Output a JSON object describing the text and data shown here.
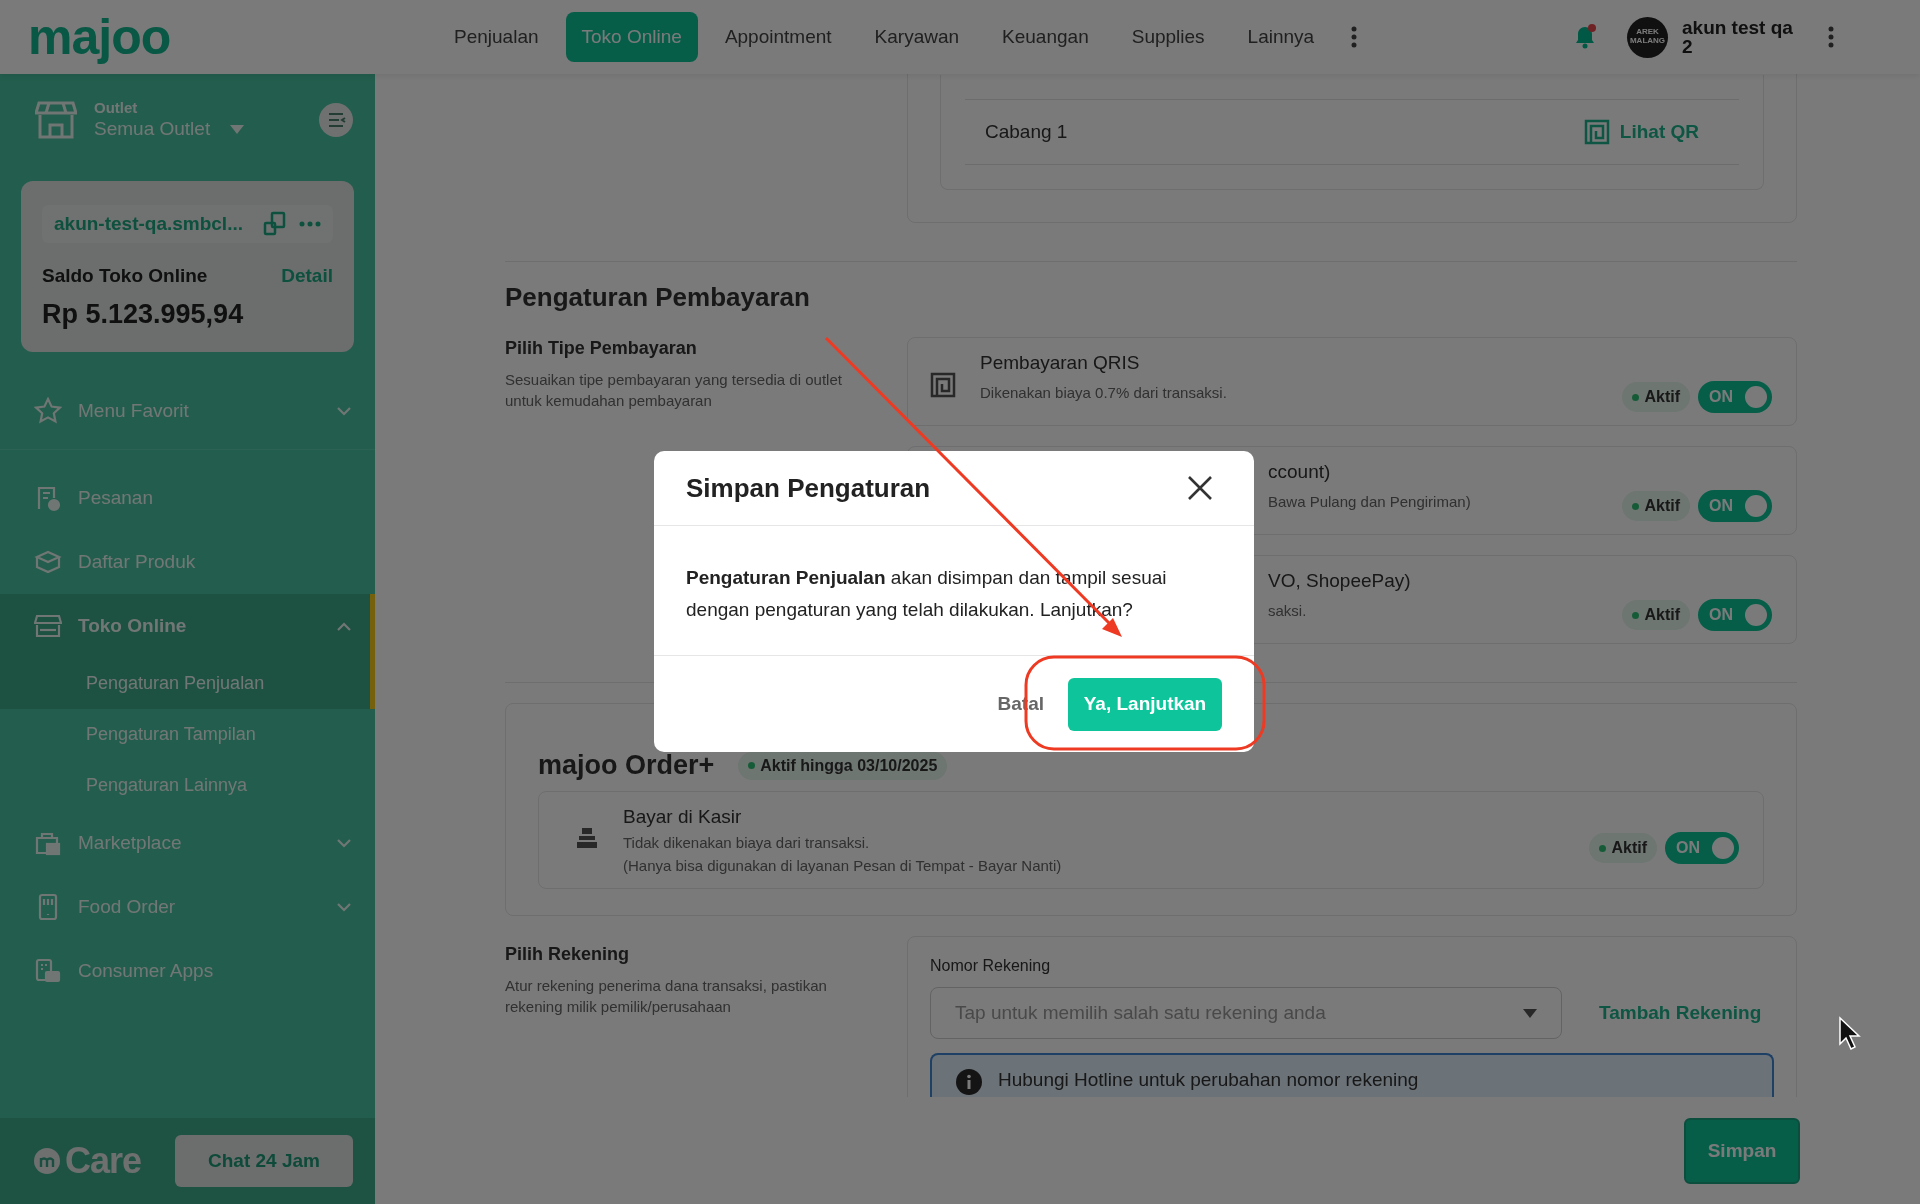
{
  "header": {
    "logo": "majoo",
    "nav": [
      {
        "label": "Penjualan",
        "selected": false
      },
      {
        "label": "Toko Online",
        "selected": true
      },
      {
        "label": "Appointment",
        "selected": false
      },
      {
        "label": "Karyawan",
        "selected": false
      },
      {
        "label": "Keuangan",
        "selected": false
      },
      {
        "label": "Supplies",
        "selected": false
      },
      {
        "label": "Lainnya",
        "selected": false
      }
    ],
    "notification": {
      "unread": true
    },
    "user": {
      "avatar_text": "AREK MALANG",
      "name": "akun test qa 2"
    }
  },
  "sidebar": {
    "outlet_label": "Outlet",
    "outlet_value": "Semua Outlet",
    "store_link": "akun-test-qa.smbcl...",
    "balance_label": "Saldo Toko Online",
    "detail_link": "Detail",
    "balance": "Rp 5.123.995,94",
    "favorites": {
      "label": "Menu Favorit",
      "expanded": false
    },
    "menu": [
      {
        "label": "Pesanan",
        "selected": false
      },
      {
        "label": "Daftar Produk",
        "selected": false
      },
      {
        "label": "Toko Online",
        "selected": true,
        "expanded": true,
        "children": [
          {
            "label": "Pengaturan Penjualan",
            "selected": true
          },
          {
            "label": "Pengaturan Tampilan",
            "selected": false
          },
          {
            "label": "Pengaturan Lainnya",
            "selected": false
          }
        ]
      },
      {
        "label": "Marketplace",
        "selected": false,
        "expanded": false
      },
      {
        "label": "Food Order",
        "selected": false,
        "expanded": false
      },
      {
        "label": "Consumer Apps",
        "selected": false
      }
    ],
    "care_logo": "Care",
    "care_button": "Chat 24 Jam"
  },
  "qr_outlets": [
    {
      "name": "Cabang 1",
      "link": "Lihat QR"
    }
  ],
  "payment": {
    "title": "Pengaturan Pembayaran",
    "subtitle": "Pilih Tipe Pembayaran",
    "description": "Sesuaikan tipe pembayaran yang tersedia di outlet untuk kemudahan pembayaran",
    "methods": [
      {
        "title": "Pembayaran QRIS",
        "description": "Dikenakan biaya 0.7% dari transaksi.",
        "status": "Aktif",
        "toggle": "ON",
        "on": true,
        "partial": false
      },
      {
        "title": "ccount)",
        "description": "Bawa Pulang dan Pengiriman)",
        "status": "Aktif",
        "toggle": "ON",
        "on": true,
        "partial": true
      },
      {
        "title": "VO, ShopeePay)",
        "description": "saksi.",
        "status": "Aktif",
        "toggle": "ON",
        "on": true,
        "partial": true
      }
    ]
  },
  "order_plus": {
    "title": "majoo Order+",
    "badge": "Aktif hingga 03/10/2025",
    "methods": [
      {
        "title": "Bayar di Kasir",
        "description": "Tidak dikenakan biaya dari transaksi.",
        "note": "(Hanya bisa digunakan di layanan Pesan di Tempat - Bayar Nanti)",
        "status": "Aktif",
        "toggle": "ON",
        "on": true
      }
    ]
  },
  "account": {
    "title": "Pilih Rekening",
    "description": "Atur rekening penerima dana transaksi, pastikan rekening milik pemilik/perusahaan",
    "field_label": "Nomor Rekening",
    "placeholder": "Tap untuk memilih salah satu rekening anda",
    "add_link": "Tambah Rekening",
    "info": "Hubungi Hotline untuk perubahan nomor rekening"
  },
  "save_button": "Simpan",
  "modal": {
    "title": "Simpan Pengaturan",
    "body": "**Pengaturan Penjualan** akan disimpan dan tampil sesuai dengan pengaturan yang telah dilakukan. Lanjutkan?",
    "cancel": "Batal",
    "confirm": "Ya, Lanjutkan"
  }
}
